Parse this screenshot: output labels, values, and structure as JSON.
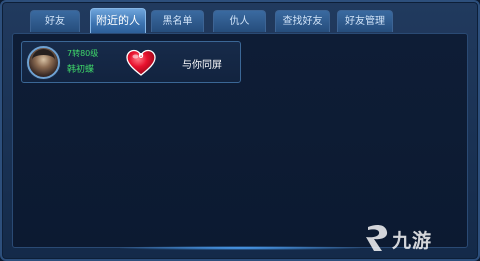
{
  "tabs": [
    {
      "label": "好友",
      "active": false
    },
    {
      "label": "附近的人",
      "active": true
    },
    {
      "label": "黑名单",
      "active": false
    },
    {
      "label": "仇人",
      "active": false
    },
    {
      "label": "查找好友",
      "active": false
    },
    {
      "label": "好友管理",
      "active": false
    }
  ],
  "nearby_player": {
    "level": "7转80级",
    "name": "韩初蝶",
    "intimacy": "0",
    "status": "与你同屏"
  },
  "watermark": {
    "text": "九游"
  },
  "colors": {
    "level_text": "#3fd86a",
    "heart": "#e8112d",
    "active_tab": "#4a86c4"
  }
}
